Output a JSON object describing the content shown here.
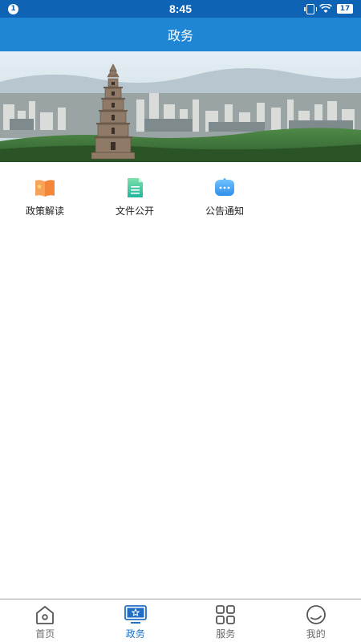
{
  "status_bar": {
    "notification_count": "1",
    "time": "8:45",
    "battery": "17"
  },
  "header": {
    "title": "政务"
  },
  "quick_menu": {
    "items": [
      {
        "label": "政策解读",
        "icon": "policy-book-icon",
        "color": "#f4863a"
      },
      {
        "label": "文件公开",
        "icon": "document-icon",
        "color": "#2fbf8f"
      },
      {
        "label": "公告通知",
        "icon": "message-bubble-icon",
        "color": "#3a9ef0"
      }
    ]
  },
  "bottom_nav": {
    "active_color": "#1f6fc6",
    "items": [
      {
        "label": "首页",
        "icon": "home-icon"
      },
      {
        "label": "政务",
        "icon": "government-affairs-icon"
      },
      {
        "label": "服务",
        "icon": "grid-icon"
      },
      {
        "label": "我的",
        "icon": "profile-circle-icon"
      }
    ]
  }
}
